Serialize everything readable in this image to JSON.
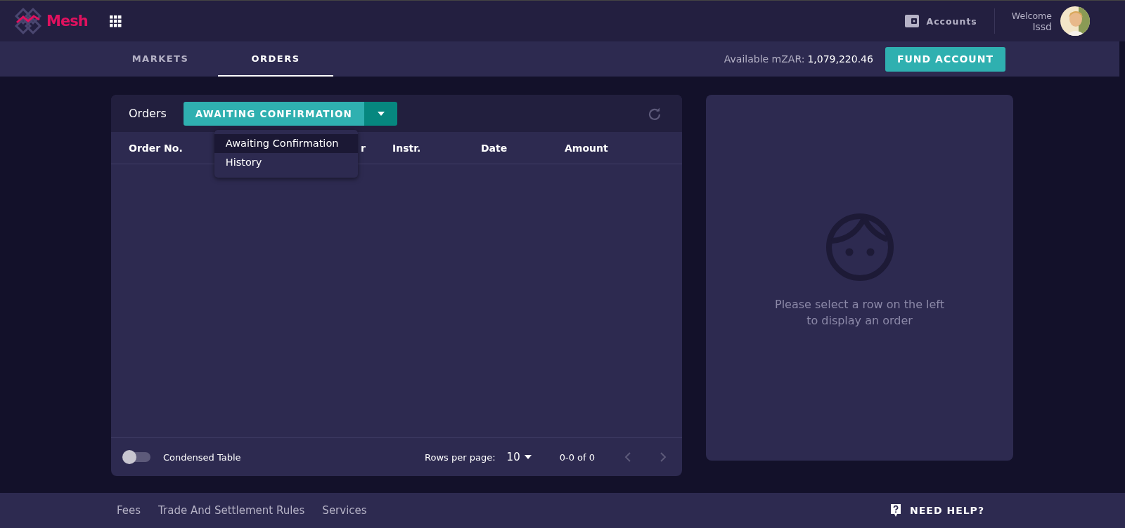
{
  "header": {
    "brand": "Mesh",
    "accounts_label": "Accounts",
    "welcome": "Welcome",
    "user": "Issd"
  },
  "tabs": [
    {
      "label": "MARKETS",
      "selected": false
    },
    {
      "label": "ORDERS",
      "selected": true
    }
  ],
  "balance": {
    "label": "Available mZAR:",
    "value": "1,079,220.46"
  },
  "fund_button": "FUND ACCOUNT",
  "orders": {
    "title": "Orders",
    "filter": "AWAITING CONFIRMATION",
    "menu": [
      {
        "label": "Awaiting Confirmation",
        "selected": true
      },
      {
        "label": "History",
        "selected": false
      }
    ],
    "columns": [
      "Order No.",
      "r",
      "Instr.",
      "Date",
      "Amount"
    ],
    "condensed": {
      "label": "Condensed Table",
      "on": false
    },
    "rows_per_page_label": "Rows per page:",
    "rows_per_page": "10",
    "range": "0-0 of 0"
  },
  "detail": {
    "message": "Please select a row on the left to display an order"
  },
  "footer": {
    "links": [
      "Fees",
      "Trade And Settlement Rules",
      "Services"
    ],
    "help": "NEED HELP?"
  }
}
